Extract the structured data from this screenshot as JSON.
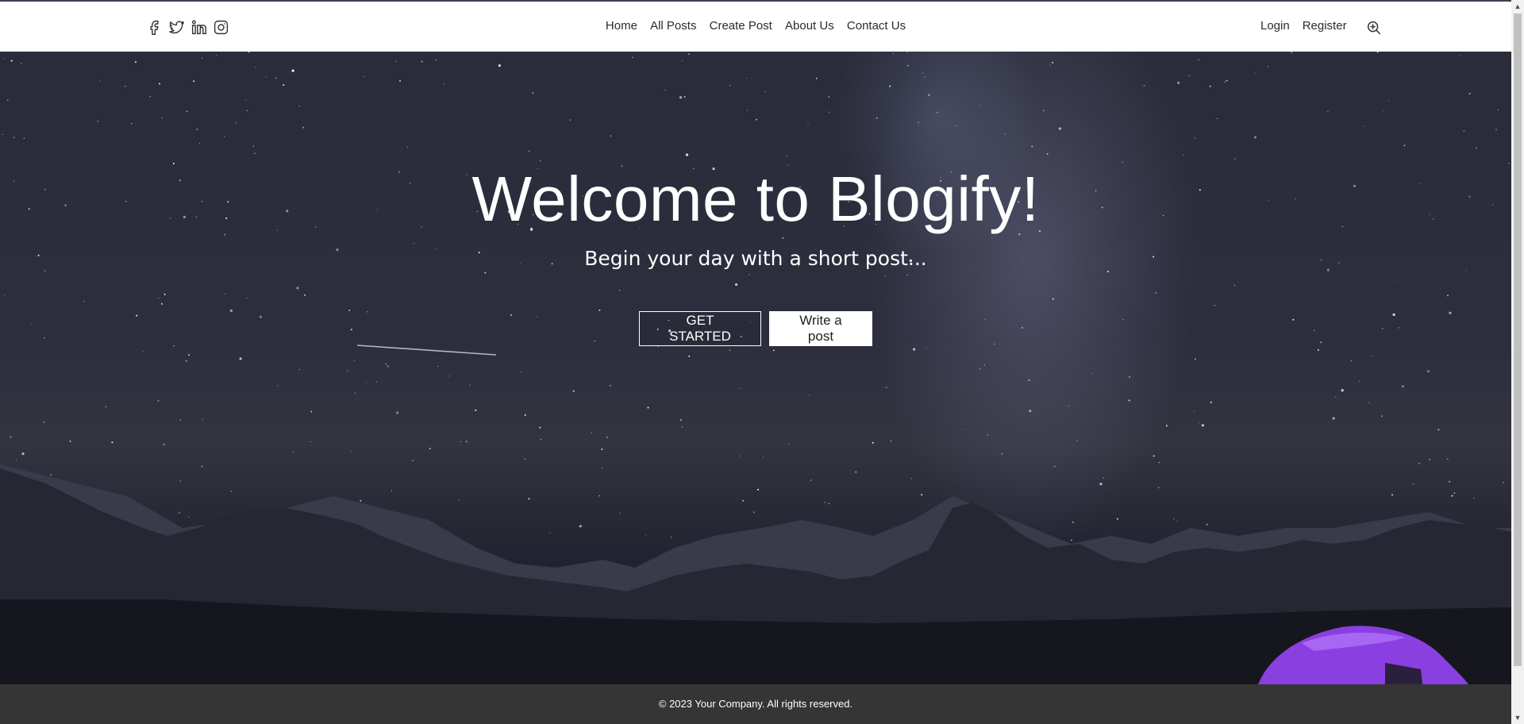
{
  "header": {
    "social": [
      {
        "name": "facebook-icon"
      },
      {
        "name": "twitter-icon"
      },
      {
        "name": "linkedin-icon"
      },
      {
        "name": "instagram-icon"
      }
    ],
    "nav": {
      "home": "Home",
      "all_posts": "All Posts",
      "create_post": "Create Post",
      "about_us": "About Us",
      "contact_us": "Contact Us"
    },
    "auth": {
      "login": "Login",
      "register": "Register"
    },
    "search_icon": "zoom-in-search-icon"
  },
  "hero": {
    "title": "Welcome to Blogify!",
    "subtitle": "Begin your day with a short post...",
    "primary_button": "GET STARTED",
    "secondary_button": "Write a post"
  },
  "footer": {
    "copyright": "© 2023 Your Company. All rights reserved."
  },
  "colors": {
    "header_bg": "#ffffff",
    "footer_bg": "#353535",
    "hero_sky": "#2c2e3d",
    "tent": "#8a3fe0"
  }
}
